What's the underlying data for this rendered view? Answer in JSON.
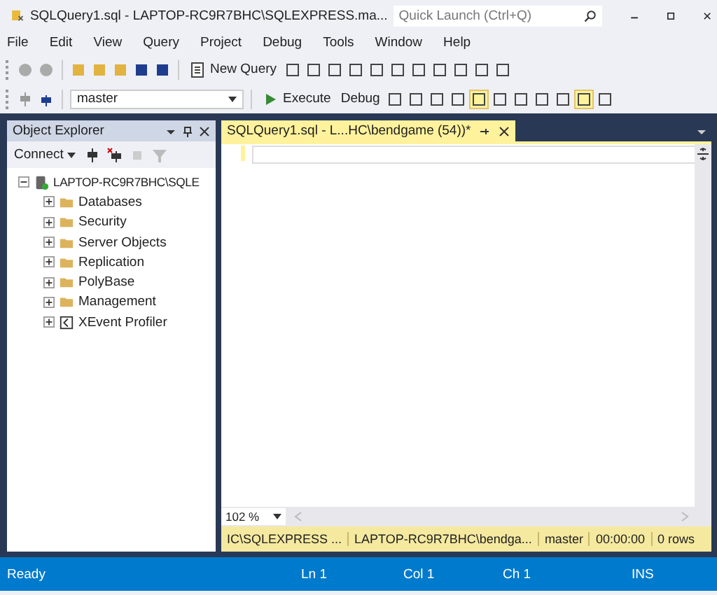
{
  "window": {
    "title": "SQLQuery1.sql - LAPTOP-RC9R7BHC\\SQLEXPRESS.ma...",
    "search_placeholder": "Quick Launch (Ctrl+Q)"
  },
  "menu": [
    "File",
    "Edit",
    "View",
    "Query",
    "Project",
    "Debug",
    "Tools",
    "Window",
    "Help"
  ],
  "toolbar": {
    "new_query": "New Query",
    "database": "master",
    "execute": "Execute",
    "debug": "Debug"
  },
  "object_explorer": {
    "title": "Object Explorer",
    "connect": "Connect",
    "tree": [
      {
        "label": "LAPTOP-RC9R7BHC\\SQLE",
        "kind": "server",
        "expanded": true,
        "children": [
          {
            "label": "Databases",
            "kind": "folder",
            "expanded": false
          },
          {
            "label": "Security",
            "kind": "folder",
            "expanded": false
          },
          {
            "label": "Server Objects",
            "kind": "folder",
            "expanded": false
          },
          {
            "label": "Replication",
            "kind": "folder",
            "expanded": false
          },
          {
            "label": "PolyBase",
            "kind": "folder",
            "expanded": false
          },
          {
            "label": "Management",
            "kind": "folder",
            "expanded": false
          },
          {
            "label": "XEvent Profiler",
            "kind": "profiler",
            "expanded": false
          }
        ]
      }
    ]
  },
  "editor": {
    "tab": {
      "label": "SQLQuery1.sql - L...HC\\bendgame (54))*",
      "selected": true
    },
    "zoom": "102 %"
  },
  "query_status": [
    "IC\\SQLEXPRESS ...",
    "LAPTOP-RC9R7BHC\\bendga...",
    "master",
    "00:00:00",
    "0 rows"
  ],
  "status_bar": {
    "state": "Ready",
    "ln": "Ln 1",
    "col": "Col 1",
    "ch": "Ch 1",
    "mode": "INS"
  }
}
